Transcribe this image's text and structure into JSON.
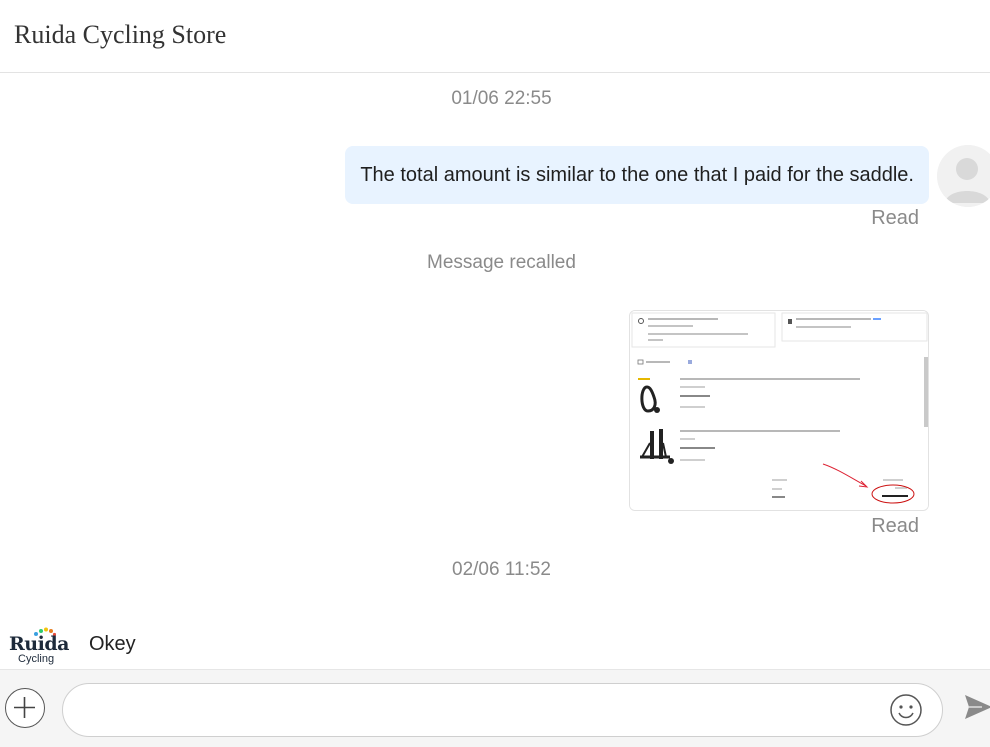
{
  "header": {
    "store_name": "Ruida Cycling Store"
  },
  "messages": {
    "timestamp_1": "01/06 22:55",
    "outgoing_text": "The total amount is similar to the one that I paid for the saddle.",
    "read_label_1": "Read",
    "recalled_text": "Message recalled",
    "read_label_2": "Read",
    "timestamp_2": "02/06 11:52",
    "incoming_text": "Okey"
  },
  "logo": {
    "word": "Ruida",
    "sub": "Cycling"
  },
  "input": {
    "placeholder": ""
  },
  "icons": {
    "attach": "plus-icon",
    "emoji": "emoji-icon",
    "send": "send-icon",
    "avatar": "user-avatar-icon"
  },
  "colors": {
    "outgoing_bubble": "#e8f3ff",
    "muted_text": "#8a8a8a",
    "input_bar_bg": "#f5f5f5"
  }
}
